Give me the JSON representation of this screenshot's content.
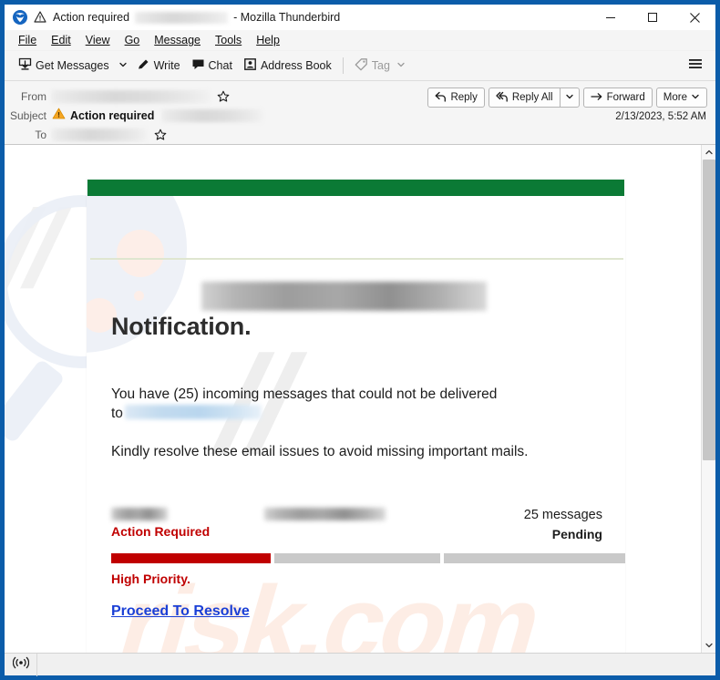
{
  "window": {
    "title_prefix": "Action required",
    "title_suffix": "- Mozilla Thunderbird",
    "logo_icon": "thunderbird-logo-icon",
    "warning_icon": "warning-triangle-icon",
    "controls": {
      "minimize": "—",
      "maximize": "☐",
      "close": "✕"
    }
  },
  "menubar": {
    "items": [
      {
        "label": "File",
        "accel": "F"
      },
      {
        "label": "Edit",
        "accel": "E"
      },
      {
        "label": "View",
        "accel": "V"
      },
      {
        "label": "Go",
        "accel": "G"
      },
      {
        "label": "Message",
        "accel": "M"
      },
      {
        "label": "Tools",
        "accel": "T"
      },
      {
        "label": "Help",
        "accel": "H"
      }
    ]
  },
  "toolbar": {
    "get_messages_label": "Get Messages",
    "get_messages_icon": "inbox-download-icon",
    "get_messages_dropdown_icon": "chevron-down-icon",
    "write_label": "Write",
    "write_icon": "pencil-icon",
    "chat_label": "Chat",
    "chat_icon": "speech-bubble-icon",
    "address_book_label": "Address Book",
    "address_book_icon": "contact-card-icon",
    "tag_label": "Tag",
    "tag_icon": "tag-icon",
    "tag_dropdown_icon": "chevron-down-icon",
    "app_menu_icon": "hamburger-menu-icon"
  },
  "message_header": {
    "from_label": "From",
    "to_label": "To",
    "subject_label": "Subject",
    "subject_text": "Action required",
    "subject_warning_icon": "warning-triangle-icon",
    "from_star_icon": "star-icon",
    "to_star_icon": "star-icon",
    "date": "2/13/2023, 5:52 AM",
    "actions": {
      "reply_label": "Reply",
      "reply_icon": "reply-arrow-icon",
      "reply_all_label": "Reply All",
      "reply_all_icon": "reply-all-arrow-icon",
      "reply_all_dropdown_icon": "chevron-down-icon",
      "forward_label": "Forward",
      "forward_icon": "forward-arrow-icon",
      "more_label": "More",
      "more_dropdown_icon": "chevron-down-icon"
    }
  },
  "email": {
    "heading": "Notification.",
    "paragraph_1_before": "You have (25) incoming messages that could not be delivered",
    "paragraph_1_after": "to",
    "paragraph_2": "Kindly resolve these email issues to avoid missing important mails.",
    "status": {
      "message_count": "25 messages",
      "pending_label": "Pending",
      "action_required_label": "Action Required",
      "high_priority_label": "High Priority."
    },
    "cta_label": "Proceed To Resolve",
    "colors": {
      "header_green": "#0b7a35",
      "alert_red": "#c00000",
      "link_blue": "#1a3fd6",
      "bar_gray": "#c9c9c9"
    },
    "watermark_text": "risk.com"
  },
  "scrollbar": {
    "up_icon": "chevron-up-icon",
    "down_icon": "chevron-down-icon"
  },
  "statusbar": {
    "connection_icon": "broadcast-signal-icon"
  }
}
